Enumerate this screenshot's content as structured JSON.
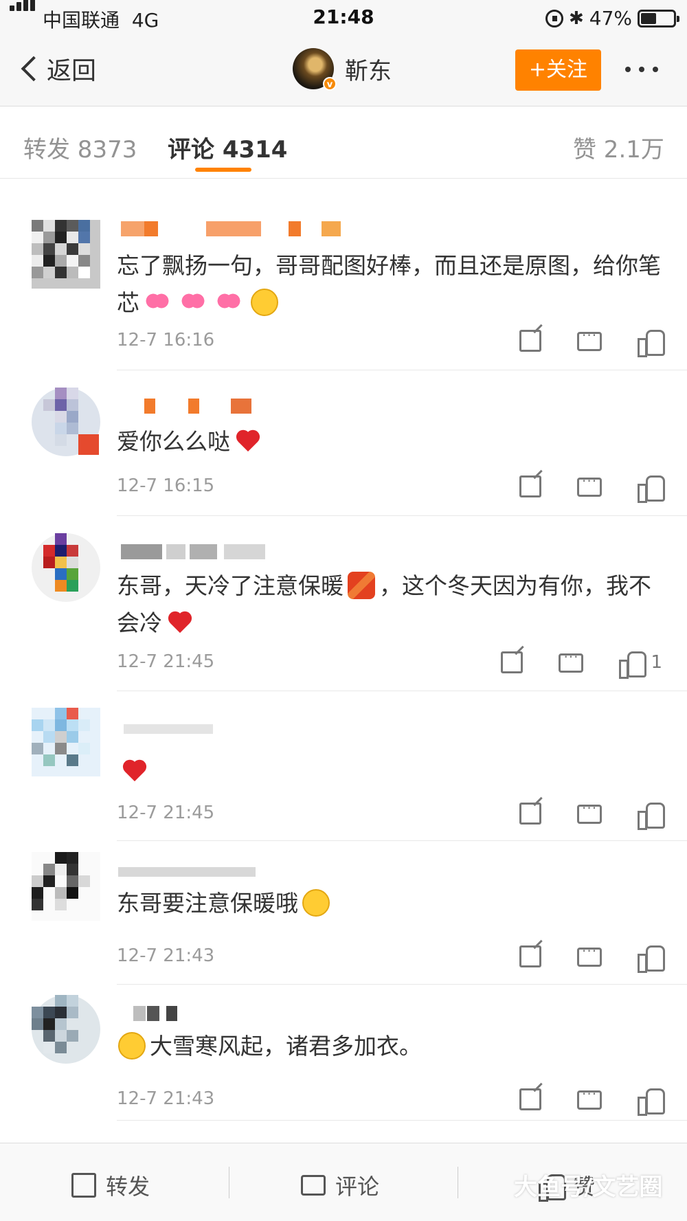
{
  "status_bar": {
    "carrier": "中国联通",
    "network": "4G",
    "time": "21:48",
    "battery_percent": "47%",
    "battery_level": 0.47
  },
  "nav": {
    "back_label": "返回",
    "username": "靳东",
    "verified_badge": "v",
    "follow_label": "+关注"
  },
  "tabs": [
    {
      "label": "转发 8373"
    },
    {
      "label": "评论 4314"
    },
    {
      "label": "赞 2.1万"
    }
  ],
  "comments": [
    {
      "text_parts": [
        "忘了飘扬一句，哥哥配图好棒，而且还是原图，给你笔芯"
      ],
      "emojis": [
        "pink-hearts",
        "pink-hearts",
        "pink-hearts",
        "laughing-face"
      ],
      "time": "12-7 16:16",
      "likes": ""
    },
    {
      "text_parts": [
        "爱你么么哒"
      ],
      "emojis": [
        "red-heart"
      ],
      "time": "12-7 16:15",
      "likes": ""
    },
    {
      "text_parts": [
        "东哥，天冷了注意保暖",
        "，这个冬天因为有你，我不会冷"
      ],
      "emojis": [
        "scarf",
        "red-heart"
      ],
      "time": "12-7 21:45",
      "likes": "1"
    },
    {
      "text_parts": [
        ""
      ],
      "emojis": [
        "red-heart"
      ],
      "time": "12-7 21:45",
      "likes": ""
    },
    {
      "text_parts": [
        "东哥要注意保暖哦"
      ],
      "emojis": [
        "hugging-face"
      ],
      "time": "12-7 21:43",
      "likes": ""
    },
    {
      "text_parts": [
        "大雪寒风起，诸君多加衣。"
      ],
      "emojis": [
        "smile-face"
      ],
      "time": "12-7 21:43",
      "likes": ""
    }
  ],
  "bottom_bar": {
    "share_label": "转发",
    "comment_label": "评论",
    "like_label": "赞"
  },
  "watermark": "大鱼号/文艺圈",
  "colors": {
    "accent": "#ff8200",
    "heart": "#e0242a"
  }
}
